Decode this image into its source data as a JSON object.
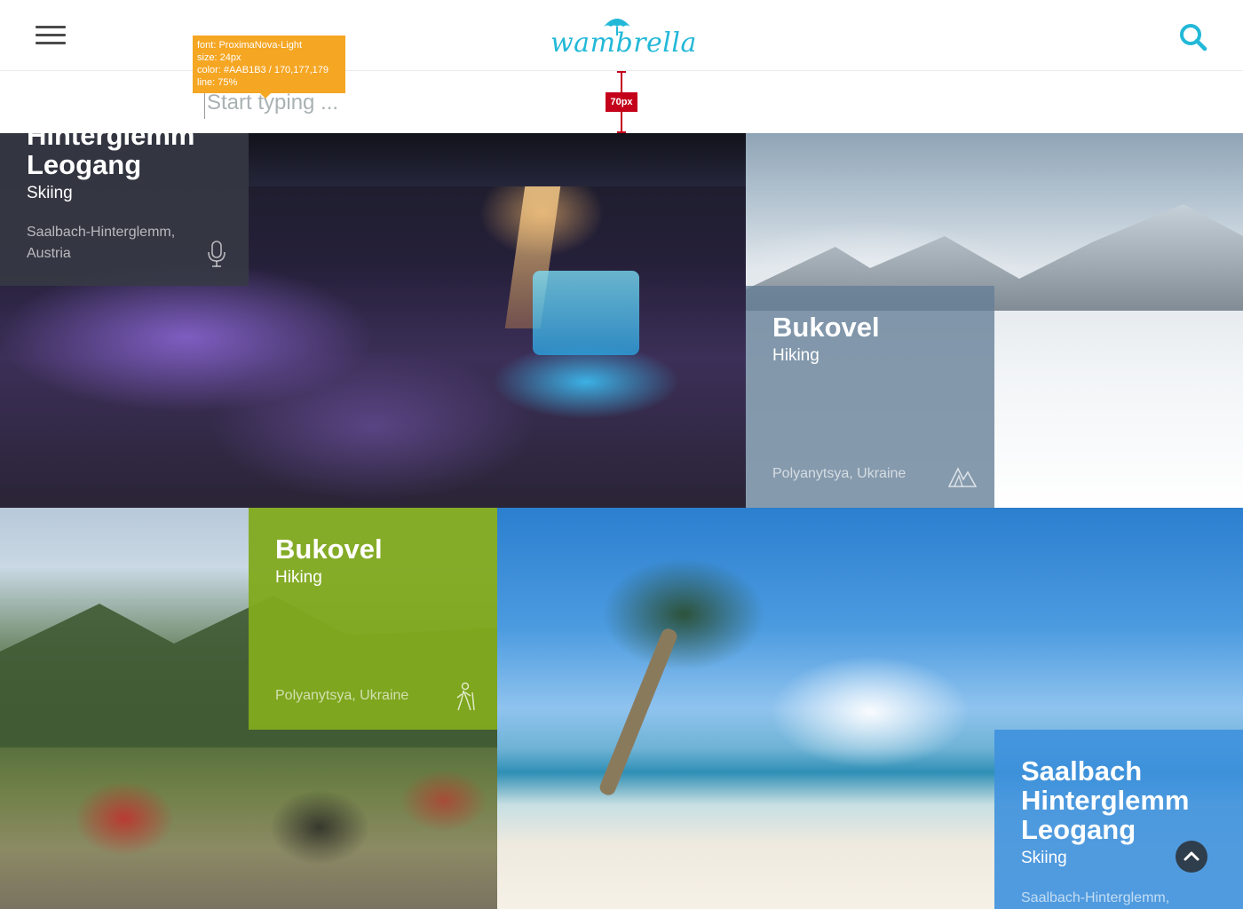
{
  "header": {
    "logo_text": "wambrella",
    "brand_color": "#22B8D8"
  },
  "search": {
    "placeholder": "Start typing ..."
  },
  "spec": {
    "line1": "font: ProximaNova-Light",
    "line2": "size: 24px",
    "line3": "color: #AAB1B3 / 170,177,179",
    "line4": "line: 75%",
    "measure": "70px"
  },
  "tiles": [
    {
      "title_line1": "Hinterglemm",
      "title_line2": "Leogang",
      "activity": "Skiing",
      "location_line1": "Saalbach-Hinterglemm,",
      "location_line2": "Austria",
      "icon": "microphone-icon"
    },
    {
      "title": "Bukovel",
      "activity": "Hiking",
      "location": "Polyanytsya, Ukraine",
      "icon": "mountains-icon"
    },
    {
      "title": "Bukovel",
      "activity": "Hiking",
      "location": "Polyanytsya, Ukraine",
      "icon": "hiker-icon"
    },
    {
      "title_line1": "Saalbach",
      "title_line2": "Hinterglemm",
      "title_line3": "Leogang",
      "activity": "Skiing",
      "location": "Saalbach-Hinterglemm,"
    }
  ]
}
